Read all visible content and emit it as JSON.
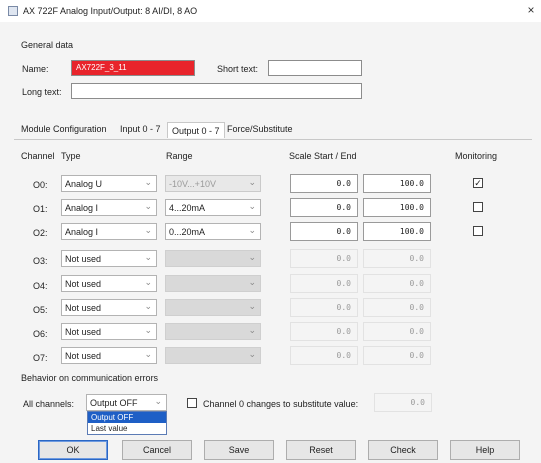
{
  "window": {
    "title": "AX 722F Analog Input/Output: 8 AI/DI, 8 AO",
    "close_glyph": "×"
  },
  "general": {
    "heading": "General data",
    "name_label": "Name:",
    "name_value": "AX722F_3_11",
    "short_text_label": "Short text:",
    "short_text_value": "",
    "long_text_label": "Long text:",
    "long_text_value": ""
  },
  "tabs": [
    {
      "label": "Module Configuration"
    },
    {
      "label": "Input 0 - 7"
    },
    {
      "label": "Output 0 - 7"
    },
    {
      "label": "Force/Substitute"
    }
  ],
  "table": {
    "headers": {
      "channel": "Channel",
      "type": "Type",
      "range": "Range",
      "scale": "Scale Start / End",
      "monitoring": "Monitoring"
    },
    "rows": [
      {
        "channel": "O0:",
        "type": "Analog U",
        "range": "-10V...+10V",
        "start": "0.0",
        "end": "100.0",
        "monitoring": "checked"
      },
      {
        "channel": "O1:",
        "type": "Analog I",
        "range": "4...20mA",
        "start": "0.0",
        "end": "100.0",
        "monitoring": "unchecked"
      },
      {
        "channel": "O2:",
        "type": "Analog I",
        "range": "0...20mA",
        "start": "0.0",
        "end": "100.0",
        "monitoring": "unchecked"
      },
      {
        "channel": "O3:",
        "type": "Not used",
        "range": "",
        "start": "0.0",
        "end": "0.0",
        "monitoring": "none"
      },
      {
        "channel": "O4:",
        "type": "Not used",
        "range": "",
        "start": "0.0",
        "end": "0.0",
        "monitoring": "none"
      },
      {
        "channel": "O5:",
        "type": "Not used",
        "range": "",
        "start": "0.0",
        "end": "0.0",
        "monitoring": "none"
      },
      {
        "channel": "O6:",
        "type": "Not used",
        "range": "",
        "start": "0.0",
        "end": "0.0",
        "monitoring": "none"
      },
      {
        "channel": "O7:",
        "type": "Not used",
        "range": "",
        "start": "0.0",
        "end": "0.0",
        "monitoring": "none"
      }
    ]
  },
  "behavior": {
    "heading": "Behavior on communication errors",
    "all_channels_label": "All channels:",
    "selected": "Output OFF",
    "options": [
      "Output OFF",
      "Last value"
    ],
    "substitute_label": "Channel 0 changes to substitute value:",
    "substitute_value": "0.0"
  },
  "buttons": {
    "ok": "OK",
    "cancel": "Cancel",
    "save": "Save",
    "reset": "Reset",
    "check": "Check",
    "help": "Help"
  },
  "colors": {
    "name_field": "#e8242b",
    "selection": "#1e5fc6"
  },
  "icons": {
    "dropdown": "chevron-down-icon",
    "check": "checkmark-icon"
  }
}
